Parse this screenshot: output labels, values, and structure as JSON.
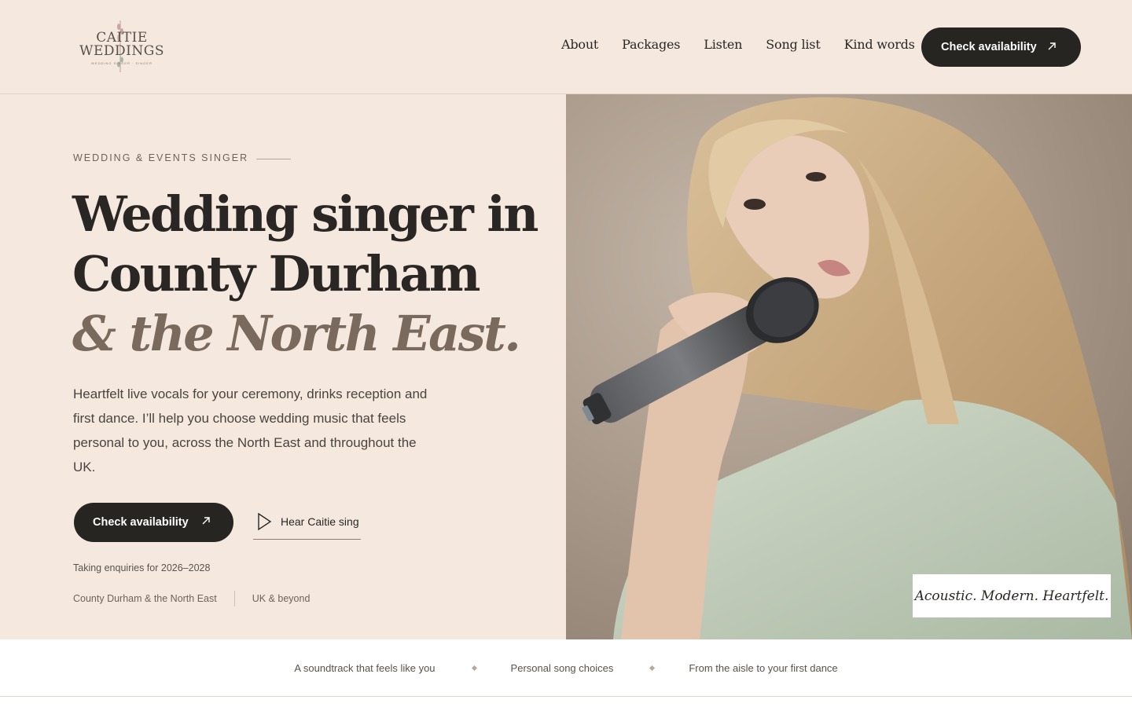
{
  "header": {
    "logo": {
      "line1": "CAITIE",
      "line2": "WEDDINGS",
      "tagline": "WEDDING SINGER · SINGER"
    },
    "nav": [
      {
        "label": "About"
      },
      {
        "label": "Packages"
      },
      {
        "label": "Listen"
      },
      {
        "label": "Song list"
      },
      {
        "label": "Kind words"
      }
    ],
    "cta_label": "Check availability",
    "cta_icon": "arrow-up-right-icon"
  },
  "hero": {
    "eyebrow": "WEDDING & EVENTS SINGER",
    "headline_line1": "Wedding singer in",
    "headline_line2": "County Durham",
    "headline_line3": "& the North East.",
    "lede": "Heartfelt live vocals for your ceremony, drinks reception and first dance. I’ll help you choose wedding music that feels personal to you, across the North East and throughout the UK.",
    "primary_button": "Check availability",
    "listen_button": "Hear Caitie sing",
    "enquiry_note": "Taking enquiries for 2026–2028",
    "locations": [
      "County Durham & the North East",
      "UK & beyond"
    ],
    "photo_caption": "Acoustic. Modern. Heartfelt."
  },
  "strip": {
    "items": [
      "A soundtrack that feels like you",
      "Personal song choices",
      "From the aisle to your first dance"
    ]
  },
  "colors": {
    "background": "#f5e9df",
    "dark_button": "#272522",
    "accent_italic": "#7a6a5e"
  }
}
